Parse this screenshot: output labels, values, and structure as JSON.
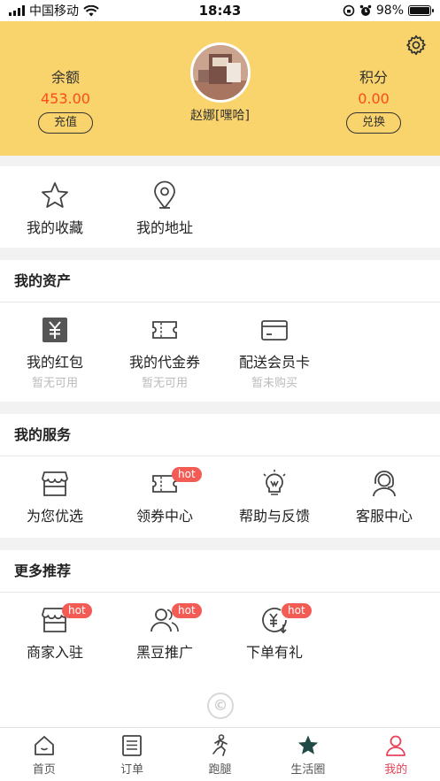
{
  "status_bar": {
    "carrier": "中国移动",
    "time": "18:43",
    "battery": "98%",
    "battery_level": 0.98
  },
  "header": {
    "balance_label": "余额",
    "balance_value": "453.00",
    "recharge_label": "充值",
    "nickname": "赵娜[嘿哈]",
    "points_label": "积分",
    "points_value": "0.00",
    "exchange_label": "兑换",
    "accent_color": "#f9d36b",
    "value_color": "#ff4b1a"
  },
  "quick": [
    {
      "label": "我的收藏",
      "icon": "star-icon"
    },
    {
      "label": "我的地址",
      "icon": "location-pin-icon"
    }
  ],
  "assets": {
    "title": "我的资产",
    "items": [
      {
        "label": "我的红包",
        "sub": "暂无可用",
        "icon": "red-packet-icon"
      },
      {
        "label": "我的代金券",
        "sub": "暂无可用",
        "icon": "voucher-icon"
      },
      {
        "label": "配送会员卡",
        "sub": "暂未购买",
        "icon": "member-card-icon"
      }
    ]
  },
  "services": {
    "title": "我的服务",
    "items": [
      {
        "label": "为您优选",
        "icon": "store-icon"
      },
      {
        "label": "领券中心",
        "icon": "coupon-icon",
        "badge": "hot"
      },
      {
        "label": "帮助与反馈",
        "icon": "lightbulb-icon"
      },
      {
        "label": "客服中心",
        "icon": "customer-service-icon"
      }
    ]
  },
  "more": {
    "title": "更多推荐",
    "items": [
      {
        "label": "商家入驻",
        "icon": "store-icon",
        "badge": "hot"
      },
      {
        "label": "黑豆推广",
        "icon": "users-icon",
        "badge": "hot"
      },
      {
        "label": "下单有礼",
        "icon": "yuan-coin-icon",
        "badge": "hot"
      }
    ]
  },
  "footer": {
    "copyright_symbol": "©"
  },
  "tabs": [
    {
      "label": "首页",
      "icon": "home-icon"
    },
    {
      "label": "订单",
      "icon": "order-list-icon"
    },
    {
      "label": "跑腿",
      "icon": "runner-icon"
    },
    {
      "label": "生活圈",
      "icon": "star-filled-icon"
    },
    {
      "label": "我的",
      "icon": "user-icon",
      "active": true
    }
  ]
}
